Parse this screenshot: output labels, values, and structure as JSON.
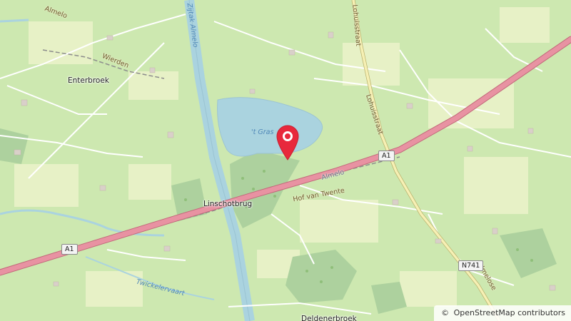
{
  "map": {
    "places": {
      "enterbroek": "Enterbroek",
      "linschotbrug": "Linschotbrug",
      "deldenerbroek": "Deldenerbroek"
    },
    "roads": {
      "almelo_nw": "Almelo",
      "wierden": "Wierden",
      "lohuisstraat_top": "Lohuisstraat",
      "lohuisstraat_mid": "Lohuisstraat",
      "hof_van_twente": "Hof van Twente",
      "almelose": "Almelose",
      "twickelervaart": "Twickelervaart"
    },
    "rail": {
      "almelo": "Almelo"
    },
    "water": {
      "lake": "'t Gras",
      "canal": "Zijtak Almelo"
    },
    "shields": {
      "a1_left": "A1",
      "a1_right": "A1",
      "n741": "N741"
    },
    "marker": {
      "icon": "map-pin-icon",
      "color": "#e8283c"
    },
    "attribution": {
      "symbol": "©",
      "text": "OpenStreetMap contributors"
    },
    "colors": {
      "land": "#cde8b0",
      "water": "#aad3df",
      "motorway": "#e892a2",
      "forest": "#add19e"
    }
  }
}
